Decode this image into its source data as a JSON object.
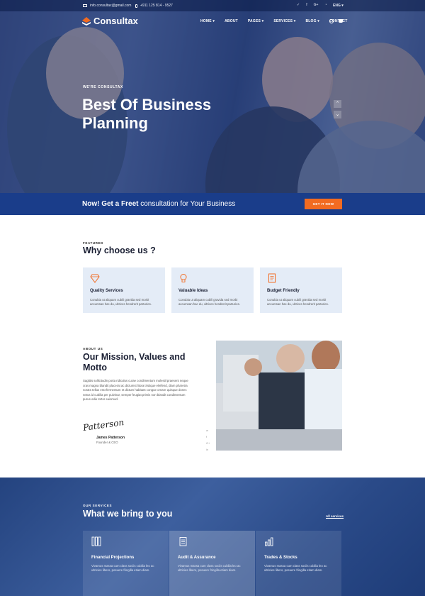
{
  "colors": {
    "primary": "#1a3d8a",
    "accent": "#f26b21",
    "card_bg": "#e4ecf7"
  },
  "topbar": {
    "email": "info.consultax@gmail.com",
    "phone": "+911 125 814 - 9527",
    "socials": [
      "twitter-icon",
      "facebook-icon",
      "google-plus-icon",
      "rss-icon"
    ],
    "social_glyphs": [
      "✓",
      "f",
      "G+",
      "◔"
    ],
    "lang": "ENG ▾"
  },
  "nav": {
    "brand": "Consultax",
    "menu": [
      "HOME ▾",
      "ABOUT",
      "PAGES ▾",
      "SERVICES ▾",
      "BLOG ▾",
      "CONTACT"
    ]
  },
  "hero": {
    "subtitle": "WE'RE CONSULTAX",
    "title": "Best Of Business Planning",
    "prev": "⌃",
    "next": "⌄"
  },
  "cta": {
    "bold": "Now! Get a Freet",
    "rest": " consultation for Your Business",
    "button": "GET IT NOW"
  },
  "featured": {
    "label": "FEATURED",
    "title": "Why choose us ?",
    "cards": [
      {
        "icon": "diamond-icon",
        "title": "Quality Services",
        "text": "Conubia ut aliquam cubili gravida sed morbi accumsan hac du, ultrices hendrerit parturies."
      },
      {
        "icon": "lightbulb-icon",
        "title": "Valuable Ideas",
        "text": "Conubia ut aliquam cubili gravida sed morbi accumsan hac du, ultrices hendrerit parturies."
      },
      {
        "icon": "document-icon",
        "title": "Budget Friendly",
        "text": "Conubia ut aliquam cubili gravida sed morbi accumsan hac du, ultrices hendrerit parturies."
      }
    ]
  },
  "about": {
    "label": "ABOUT US",
    "title": "Our Mission, Values and Motto",
    "text": "Sagittis sollicitudin porta ridiculus curae condimentum molestil praesent neque cras magna blandit placerat ac dictumst litora tristique eleifend, diam pharetra nostra tellus erat fermentum et dictum habitant congue ornare quisque donec netus id cubilia per pulvinar, semper feugiat primis non blandit condimentum purus odio tortor euismod.",
    "signature": "Patterson",
    "name": "James Patterson",
    "role": "Founder & CEO",
    "mini_social": [
      "w",
      "f",
      "G+",
      "in"
    ]
  },
  "services": {
    "label": "OUR SERVICES",
    "title": "What we bring to you",
    "all": "All services",
    "cards": [
      {
        "icon": "books-icon",
        "title": "Financial Projections",
        "text": "Vivamus massa cum class sociis cubilia leo ac ultricies libero, posuere fringilla etiam diam."
      },
      {
        "icon": "notepad-icon",
        "title": "Audit & Assurance",
        "text": "Vivamus massa cum class sociis cubilia leo ac ultricies libero, posuere fringilla etiam diam."
      },
      {
        "icon": "bar-chart-icon",
        "title": "Trades & Stocks",
        "text": "Vivamus massa cum class sociis cubilia leo ac ultricies libero, posuere fringilla etiam diam."
      }
    ]
  }
}
